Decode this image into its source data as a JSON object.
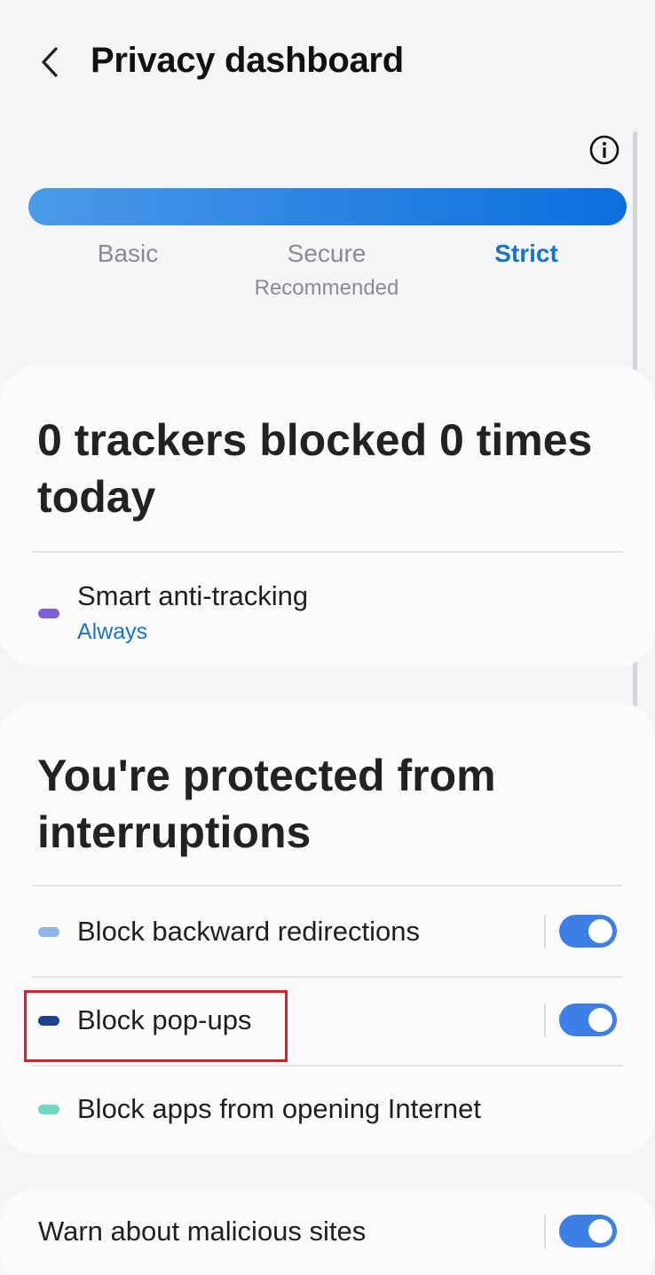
{
  "header": {
    "title": "Privacy dashboard"
  },
  "protection_levels": {
    "options": [
      {
        "label": "Basic",
        "selected": false
      },
      {
        "label": "Secure",
        "sublabel": "Recommended",
        "selected": false
      },
      {
        "label": "Strict",
        "selected": true
      }
    ]
  },
  "trackers_card": {
    "heading": "0 trackers blocked 0 times today",
    "rows": [
      {
        "label": "Smart anti-tracking",
        "sublabel": "Always",
        "dot_color": "#7e5fd1"
      }
    ]
  },
  "interruptions_card": {
    "heading": "You're protected from interruptions",
    "rows": [
      {
        "label": "Block backward redirections",
        "dot_color": "#8fb4e6",
        "toggle_on": true
      },
      {
        "label": "Block pop-ups",
        "dot_color": "#1f3f8f",
        "toggle_on": true
      },
      {
        "label": "Block apps from opening Internet",
        "dot_color": "#6fd6bf"
      }
    ]
  },
  "malicious_card": {
    "label": "Warn about malicious sites",
    "toggle_on": true
  },
  "colors": {
    "accent": "#1b73c9",
    "toggle": "#3e7fe6",
    "highlight": "#e01b22"
  }
}
